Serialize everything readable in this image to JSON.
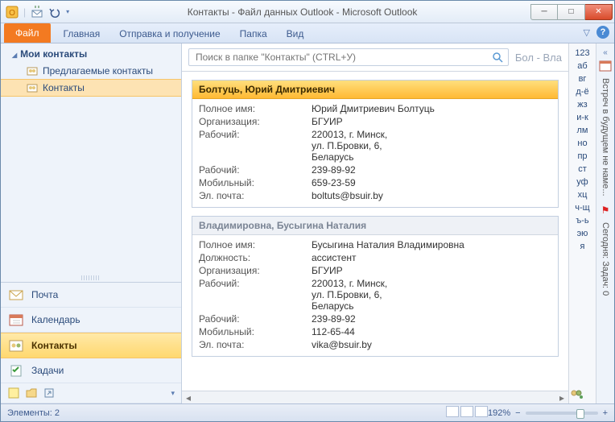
{
  "window": {
    "title": "Контакты - Файл данных Outlook  -  Microsoft Outlook"
  },
  "ribbon": {
    "file": "Файл",
    "tabs": [
      "Главная",
      "Отправка и получение",
      "Папка",
      "Вид"
    ]
  },
  "nav": {
    "header": "Мои контакты",
    "items": [
      {
        "label": "Предлагаемые контакты"
      },
      {
        "label": "Контакты"
      }
    ],
    "modules": {
      "mail": "Почта",
      "calendar": "Календарь",
      "contacts": "Контакты",
      "tasks": "Задачи"
    }
  },
  "search": {
    "placeholder": "Поиск в папке \"Контакты\" (CTRL+У)",
    "rangeLabel": "Бол - Вла"
  },
  "cards": [
    {
      "name": "Болтуць, Юрий Дмитриевич",
      "fields": [
        {
          "label": "Полное имя:",
          "value": "Юрий Дмитриевич Болтуць"
        },
        {
          "label": "Организация:",
          "value": "БГУИР"
        },
        {
          "label": "Рабочий:",
          "value": "220013, г. Минск,\nул. П.Бровки, 6,\nБеларусь"
        },
        {
          "label": "Рабочий:",
          "value": "239-89-92"
        },
        {
          "label": "Мобильный:",
          "value": "659-23-59"
        },
        {
          "label": "Эл. почта:",
          "value": "boltuts@bsuir.by"
        }
      ]
    },
    {
      "name": "Владимировна, Бусыгина Наталия",
      "fields": [
        {
          "label": "Полное имя:",
          "value": "Бусыгина Наталия Владимировна"
        },
        {
          "label": "Должность:",
          "value": "ассистент"
        },
        {
          "label": "Организация:",
          "value": "БГУИР"
        },
        {
          "label": "Рабочий:",
          "value": "220013, г. Минск,\nул. П.Бровки, 6,\nБеларусь"
        },
        {
          "label": "Рабочий:",
          "value": "239-89-92"
        },
        {
          "label": "Мобильный:",
          "value": "112-65-44"
        },
        {
          "label": "Эл. почта:",
          "value": "vika@bsuir.by"
        }
      ]
    }
  ],
  "alphabet": [
    "123",
    "аб",
    "вг",
    "д-ё",
    "жз",
    "и-к",
    "лм",
    "но",
    "пр",
    "ст",
    "уф",
    "хц",
    "ч-щ",
    "ъ-ь",
    "эю",
    "я"
  ],
  "todo": {
    "line1": "Встреч в будущем не наме...",
    "line2": "Сегодня: Задач: 0"
  },
  "status": {
    "items": "Элементы: 2",
    "zoom": "192%"
  }
}
